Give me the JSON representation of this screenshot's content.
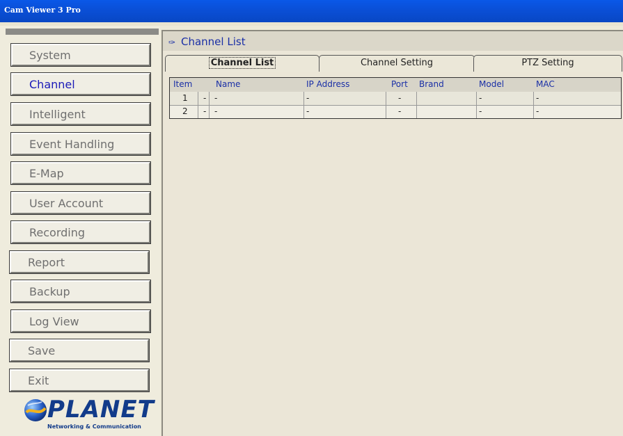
{
  "window": {
    "title": "Cam Viewer 3 Pro"
  },
  "sidebar": {
    "items": [
      {
        "label": "System",
        "active": false
      },
      {
        "label": "Channel",
        "active": true
      },
      {
        "label": "Intelligent",
        "active": false
      },
      {
        "label": "Event Handling",
        "active": false
      },
      {
        "label": "E-Map",
        "active": false
      },
      {
        "label": "User Account",
        "active": false
      },
      {
        "label": "Recording",
        "active": false
      },
      {
        "label": "Report",
        "active": false
      },
      {
        "label": "Backup",
        "active": false
      },
      {
        "label": "Log View",
        "active": false
      },
      {
        "label": "Save",
        "active": false
      },
      {
        "label": "Exit",
        "active": false
      }
    ],
    "logo": {
      "wordmark": "PLANET",
      "tagline": "Networking & Communication"
    }
  },
  "panel": {
    "title": "Channel List",
    "title_icon": "network-icon",
    "tabs": [
      {
        "label": "Channel List",
        "active": true
      },
      {
        "label": "Channel Setting",
        "active": false
      },
      {
        "label": "PTZ Setting",
        "active": false
      }
    ]
  },
  "table": {
    "columns": [
      "Item",
      "Name",
      "IP Address",
      "Port",
      "Brand",
      "Model",
      "MAC"
    ],
    "rows": [
      {
        "item": "1",
        "flag": "-",
        "name": "-",
        "ip": "-",
        "port": "-",
        "brand": "",
        "model": "-",
        "mac": "-"
      },
      {
        "item": "2",
        "flag": "-",
        "name": "-",
        "ip": "-",
        "port": "-",
        "brand": "",
        "model": "-",
        "mac": "-"
      }
    ]
  },
  "colors": {
    "accent": "#1a2fa6",
    "titlebar": "#0a4fd6",
    "background": "#ece9d8"
  }
}
